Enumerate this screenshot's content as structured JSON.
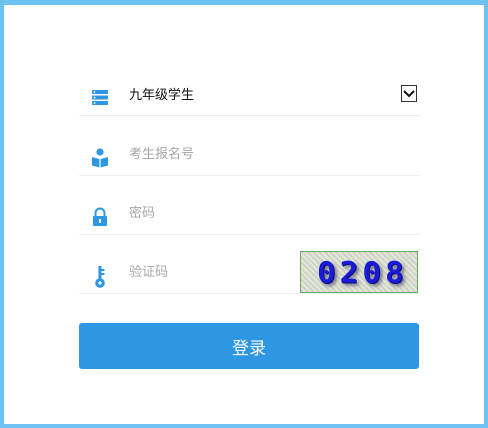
{
  "form": {
    "grade_select": {
      "value": "九年级学生",
      "icon": "list-icon"
    },
    "exam_number": {
      "placeholder": "考生报名号",
      "icon": "book-user-icon"
    },
    "password": {
      "placeholder": "密码",
      "icon": "lock-icon"
    },
    "captcha": {
      "placeholder": "验证码",
      "icon": "key-icon",
      "image_text": "0208"
    },
    "login_label": "登录"
  },
  "colors": {
    "accent": "#2e97e3",
    "frame": "#6ec2f2"
  }
}
